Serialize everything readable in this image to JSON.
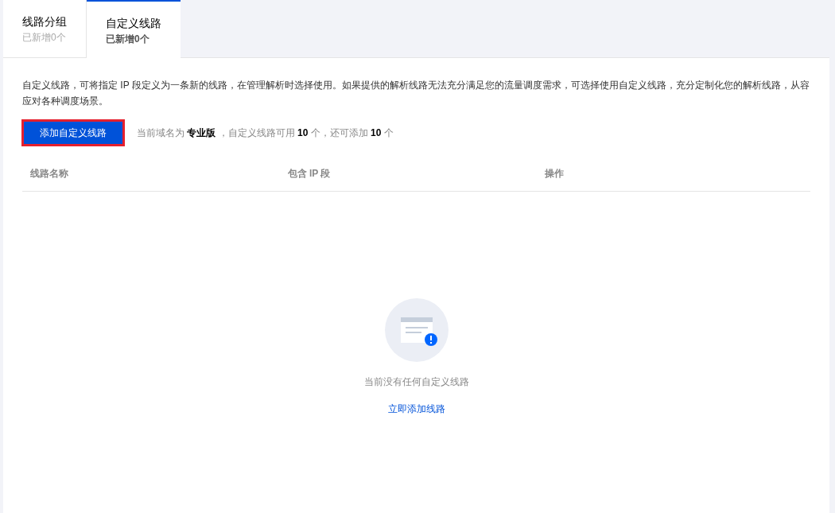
{
  "tabs": [
    {
      "label": "线路分组",
      "count": "已新增0个",
      "selected": false
    },
    {
      "label": "自定义线路",
      "count": "已新增0个",
      "selected": true
    }
  ],
  "description": "自定义线路，可将指定 IP 段定义为一条新的线路，在管理解析时选择使用。如果提供的解析线路无法充分满足您的流量调度需求，可选择使用自定义线路，充分定制化您的解析线路，从容应对各种调度场景。",
  "add_button": "添加自定义线路",
  "quota_info": "当前域名为 **专业版** ，自定义线路可用 **10** 个，还可添加 **10** 个",
  "table": {
    "columns": [
      "线路名称",
      "包含 IP 段",
      "操作"
    ]
  },
  "empty_state": {
    "message": "当前没有任何自定义线路",
    "action": "立即添加线路"
  }
}
